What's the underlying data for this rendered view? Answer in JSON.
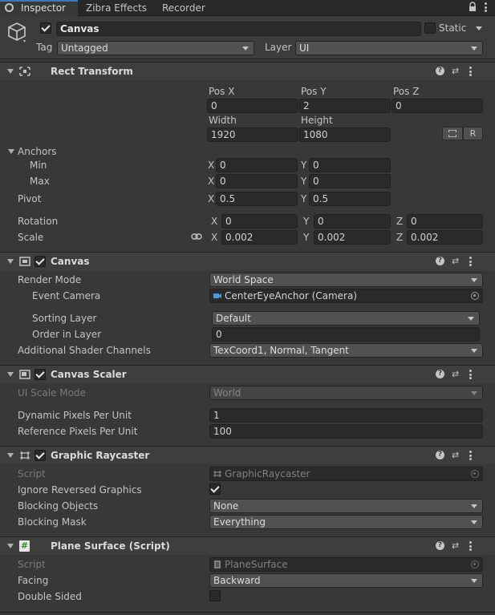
{
  "tabs": {
    "inspector": "Inspector",
    "zibra": "Zibra Effects",
    "recorder": "Recorder"
  },
  "object": {
    "name": "Canvas",
    "static_label": "Static",
    "tag_label": "Tag",
    "tag_value": "Untagged",
    "layer_label": "Layer",
    "layer_value": "UI"
  },
  "rect_transform": {
    "title": "Rect Transform",
    "pos_x_label": "Pos X",
    "pos_y_label": "Pos Y",
    "pos_z_label": "Pos Z",
    "pos_x": "0",
    "pos_y": "2",
    "pos_z": "0",
    "width_label": "Width",
    "height_label": "Height",
    "width": "1920",
    "height": "1080",
    "r_button": "R",
    "anchors_label": "Anchors",
    "min_label": "Min",
    "max_label": "Max",
    "min_x": "0",
    "min_y": "0",
    "max_x": "0",
    "max_y": "0",
    "pivot_label": "Pivot",
    "pivot_x": "0.5",
    "pivot_y": "0.5",
    "rotation_label": "Rotation",
    "rot_x": "0",
    "rot_y": "0",
    "rot_z": "0",
    "scale_label": "Scale",
    "scale_x": "0.002",
    "scale_y": "0.002",
    "scale_z": "0.002",
    "x": "X",
    "y": "Y",
    "z": "Z"
  },
  "canvas": {
    "title": "Canvas",
    "render_mode_label": "Render Mode",
    "render_mode": "World Space",
    "event_camera_label": "Event Camera",
    "event_camera": "CenterEyeAnchor (Camera)",
    "sorting_layer_label": "Sorting Layer",
    "sorting_layer": "Default",
    "order_label": "Order in Layer",
    "order": "0",
    "shader_channels_label": "Additional Shader Channels",
    "shader_channels": "TexCoord1, Normal, Tangent"
  },
  "canvas_scaler": {
    "title": "Canvas Scaler",
    "ui_scale_label": "UI Scale Mode",
    "ui_scale": "World",
    "dynamic_label": "Dynamic Pixels Per Unit",
    "dynamic": "1",
    "reference_label": "Reference Pixels Per Unit",
    "reference": "100"
  },
  "graphic_raycaster": {
    "title": "Graphic Raycaster",
    "script_label": "Script",
    "script": "GraphicRaycaster",
    "ignore_label": "Ignore Reversed Graphics",
    "blocking_objects_label": "Blocking Objects",
    "blocking_objects": "None",
    "blocking_mask_label": "Blocking Mask",
    "blocking_mask": "Everything"
  },
  "plane_surface": {
    "title": "Plane Surface (Script)",
    "script_label": "Script",
    "script": "PlaneSurface",
    "facing_label": "Facing",
    "facing": "Backward",
    "double_sided_label": "Double Sided"
  },
  "help_glyph": "?",
  "icons": [
    "inspector-icon",
    "lock-icon",
    "more-icon",
    "gameobject-cube-icon",
    "rect-transform-icon",
    "canvas-icon",
    "canvas-scaler-icon",
    "raycaster-icon",
    "script-hash-icon",
    "help-icon",
    "preset-icon",
    "link-icon",
    "camera-icon",
    "object-picker-icon"
  ]
}
